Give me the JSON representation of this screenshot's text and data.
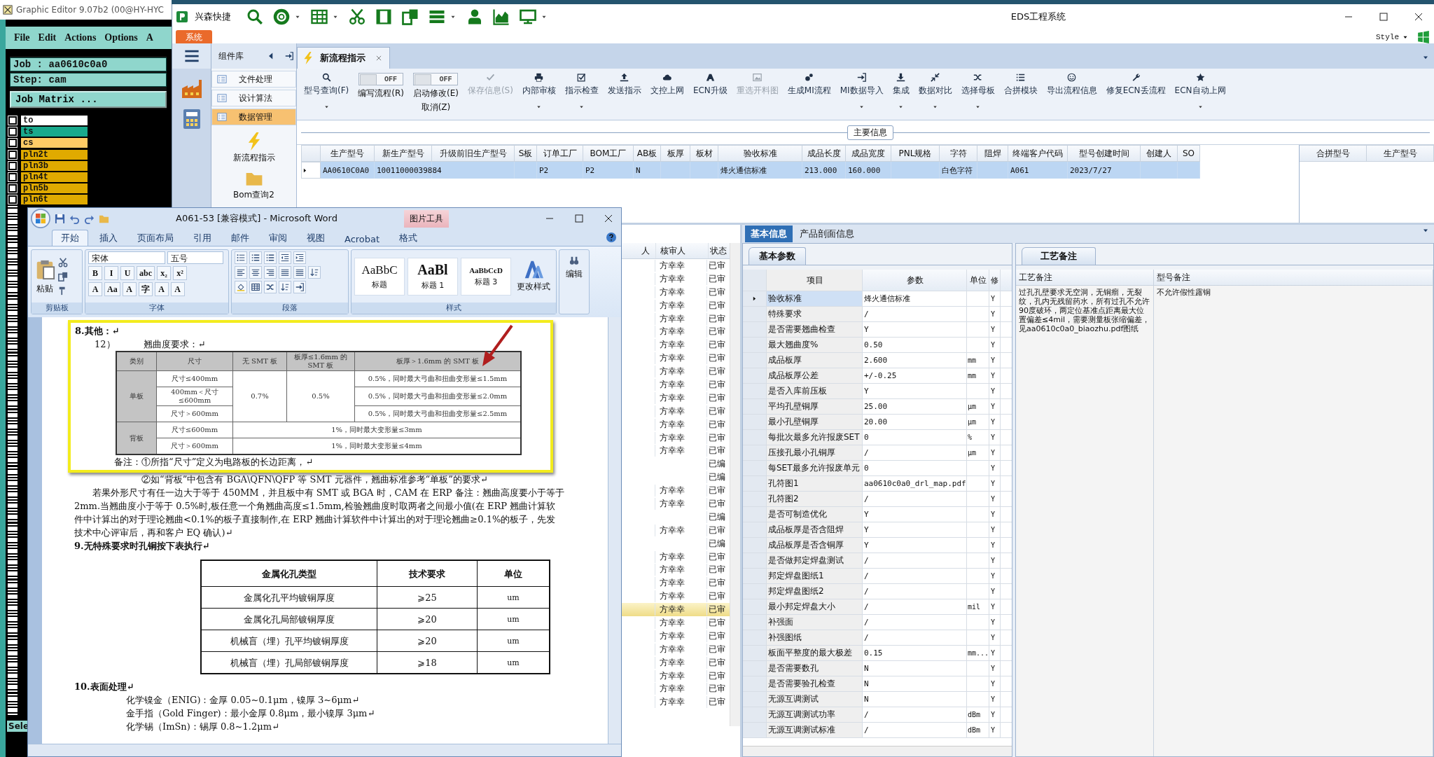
{
  "graphic_editor": {
    "title": "Graphic Editor 9.07b2 (00@HY-HYC",
    "menu": [
      "File",
      "Edit",
      "Actions",
      "Options",
      "A"
    ],
    "job": "Job : aa0610c0a0",
    "step": "Step: cam",
    "matrix_button": "Job Matrix ...",
    "layers": [
      {
        "name": "to",
        "color": "#ffffff"
      },
      {
        "name": "ts",
        "color": "#19a98c"
      },
      {
        "name": "cs",
        "color": "#ffcc66"
      },
      {
        "name": "pln2t",
        "color": "#e0aa00"
      },
      {
        "name": "pln3b",
        "color": "#e0aa00"
      },
      {
        "name": "pln4t",
        "color": "#e0aa00"
      },
      {
        "name": "pln5b",
        "color": "#e0aa00"
      },
      {
        "name": "pln6t",
        "color": "#e0aa00"
      }
    ],
    "status": "Sele"
  },
  "eds": {
    "title": "EDS工程系统",
    "quick_access_label": "兴森快捷",
    "app_tab": "系统",
    "style_menu": "Style",
    "component_panel": {
      "title": "组件库",
      "categories": [
        {
          "label": "文件处理",
          "selected": false
        },
        {
          "label": "设计算法",
          "selected": false
        },
        {
          "label": "数据管理",
          "selected": true
        }
      ],
      "items": [
        "新流程指示",
        "Bom查询2"
      ]
    },
    "doc_tab": "新流程指示",
    "ribbon": [
      {
        "kind": "button",
        "label": "型号查询(F)",
        "dropdown": true,
        "disabled": false
      },
      {
        "kind": "toggle",
        "text": "OFF",
        "on": false,
        "label": "编写流程(R)"
      },
      {
        "kind": "toggle",
        "text": "OFF",
        "on": false,
        "label": "启动修改(E)",
        "label2": "取消(Z)"
      },
      {
        "kind": "button",
        "label": "保存信息(S)",
        "dropdown": false,
        "disabled": true
      },
      {
        "kind": "button",
        "label": "内部审核",
        "dropdown": true,
        "disabled": false
      },
      {
        "kind": "button",
        "label": "指示检查",
        "dropdown": true,
        "disabled": false
      },
      {
        "kind": "button",
        "label": "发送指示",
        "dropdown": false,
        "disabled": false
      },
      {
        "kind": "button",
        "label": "文控上网",
        "dropdown": false,
        "disabled": false
      },
      {
        "kind": "button",
        "label": "ECN升级",
        "dropdown": false,
        "disabled": false
      },
      {
        "kind": "button",
        "label": "重选开料图",
        "dropdown": false,
        "disabled": true
      },
      {
        "kind": "button",
        "label": "生成MI流程",
        "dropdown": false,
        "disabled": false
      },
      {
        "kind": "button",
        "label": "MI数据导入",
        "dropdown": true,
        "disabled": false
      },
      {
        "kind": "button",
        "label": "集成",
        "dropdown": true,
        "disabled": false
      },
      {
        "kind": "button",
        "label": "数据对比",
        "dropdown": true,
        "disabled": false
      },
      {
        "kind": "button",
        "label": "选择母板",
        "dropdown": true,
        "disabled": false
      },
      {
        "kind": "button",
        "label": "合拼模块",
        "dropdown": false,
        "disabled": false
      },
      {
        "kind": "button",
        "label": "导出流程信息",
        "dropdown": false,
        "disabled": false
      },
      {
        "kind": "button",
        "label": "修复ECN丢流程",
        "dropdown": false,
        "disabled": false
      },
      {
        "kind": "button",
        "label": "ECN自动上网",
        "dropdown": true,
        "disabled": false
      }
    ],
    "main_info": {
      "title": "主要信息",
      "row_selected": true,
      "columns": [
        {
          "header": "生产型号",
          "value": "AA0610C0A0"
        },
        {
          "header": "新生产型号",
          "value": "10011000039884"
        },
        {
          "header": "升级前旧生产型号"
        },
        {
          "header": "S板"
        },
        {
          "header": "订单工厂",
          "value": "P2"
        },
        {
          "header": "BOM工厂",
          "value": "P2"
        },
        {
          "header": "AB板",
          "value": "N"
        },
        {
          "header": "板厚"
        },
        {
          "header": "板材"
        },
        {
          "header": "验收标准",
          "value": "烽火通信标准"
        },
        {
          "header": "成品长度",
          "value": "213.000"
        },
        {
          "header": "成品宽度",
          "value": "160.000"
        },
        {
          "header": "PNL规格"
        },
        {
          "header": "字符",
          "value": "白色字符"
        },
        {
          "header": "阻焊"
        },
        {
          "header": "终端客户代码",
          "value": "A061"
        },
        {
          "header": "型号创建时间",
          "value": "2023/7/27"
        },
        {
          "header": "创建人"
        },
        {
          "header": "SO"
        }
      ]
    },
    "merge_table": {
      "columns": [
        "合拼型号",
        "生产型号"
      ]
    },
    "review_list": {
      "columns": [
        "人",
        "核审人",
        "状态"
      ],
      "rows": [
        {
          "reviewer": "方幸幸",
          "status": "已审",
          "selected": false
        },
        {
          "reviewer": "方幸幸",
          "status": "已审",
          "selected": false
        },
        {
          "reviewer": "方幸幸",
          "status": "已审",
          "selected": false
        },
        {
          "reviewer": "方幸幸",
          "status": "已审",
          "selected": false
        },
        {
          "reviewer": "方幸幸",
          "status": "已审",
          "selected": false
        },
        {
          "reviewer": "方幸幸",
          "status": "已审",
          "selected": false
        },
        {
          "reviewer": "方幸幸",
          "status": "已审",
          "selected": false
        },
        {
          "reviewer": "方幸幸",
          "status": "已审",
          "selected": false
        },
        {
          "reviewer": "方幸幸",
          "status": "已审",
          "selected": false
        },
        {
          "reviewer": "方幸幸",
          "status": "已审",
          "selected": false
        },
        {
          "reviewer": "方幸幸",
          "status": "已审",
          "selected": false
        },
        {
          "reviewer": "方幸幸",
          "status": "已审",
          "selected": false
        },
        {
          "reviewer": "方幸幸",
          "status": "已审",
          "selected": false
        },
        {
          "reviewer": "方幸幸",
          "status": "已审",
          "selected": false
        },
        {
          "reviewer": "方幸幸",
          "status": "已审",
          "selected": false
        },
        {
          "status": "已编",
          "selected": false
        },
        {
          "status": "已编",
          "selected": false
        },
        {
          "reviewer": "方幸幸",
          "status": "已审",
          "selected": false
        },
        {
          "reviewer": "方幸幸",
          "status": "已审",
          "selected": false
        },
        {
          "status": "已编",
          "selected": false
        },
        {
          "reviewer": "方幸幸",
          "status": "已审",
          "selected": false
        },
        {
          "status": "已编",
          "selected": false
        },
        {
          "reviewer": "方幸幸",
          "status": "已审",
          "selected": false
        },
        {
          "reviewer": "方幸幸",
          "status": "已审",
          "selected": false
        },
        {
          "reviewer": "方幸幸",
          "status": "已审",
          "selected": false
        },
        {
          "reviewer": "方幸幸",
          "status": "已审",
          "selected": false
        },
        {
          "reviewer": "方幸幸",
          "status": "已审",
          "selected": true
        },
        {
          "reviewer": "方幸幸",
          "status": "已审",
          "selected": false
        },
        {
          "reviewer": "方幸幸",
          "status": "已审",
          "selected": false
        },
        {
          "reviewer": "方幸幸",
          "status": "已审",
          "selected": false
        },
        {
          "reviewer": "方幸幸",
          "status": "已审",
          "selected": false
        },
        {
          "reviewer": "方幸幸",
          "status": "已审",
          "selected": false
        },
        {
          "reviewer": "方幸幸",
          "status": "已审",
          "selected": false
        },
        {
          "reviewer": "方幸幸",
          "status": "已审",
          "selected": false
        }
      ]
    },
    "basic_info": {
      "tabs": [
        {
          "label": "基本信息",
          "selected": true
        },
        {
          "label": "产品剖面信息",
          "selected": false
        }
      ],
      "subtab": "基本参数",
      "columns": [
        "项目",
        "参数",
        "单位",
        "修"
      ],
      "rows": [
        {
          "item": "验收标准",
          "value": "烽火通信标准",
          "flag": "Y",
          "selected": true
        },
        {
          "item": "特殊要求",
          "value": "/",
          "flag": "Y",
          "selected": false
        },
        {
          "item": "是否需要翘曲检查",
          "value": "Y",
          "flag": "Y",
          "selected": false
        },
        {
          "item": "最大翘曲度%",
          "value": "0.50",
          "flag": "Y",
          "selected": false
        },
        {
          "item": "成品板厚",
          "value": "2.600",
          "unit": "mm",
          "flag": "Y",
          "selected": false
        },
        {
          "item": "成品板厚公差",
          "value": "+/-0.25",
          "unit": "mm",
          "flag": "Y",
          "selected": false
        },
        {
          "item": "是否入库前压板",
          "value": "Y",
          "flag": "Y",
          "selected": false
        },
        {
          "item": "平均孔壁铜厚",
          "value": "25.00",
          "unit": "μm",
          "flag": "Y",
          "selected": false
        },
        {
          "item": "最小孔壁铜厚",
          "value": "20.00",
          "unit": "μm",
          "flag": "Y",
          "selected": false
        },
        {
          "item": "每批次最多允许报废SET",
          "value": "0",
          "unit": "%",
          "flag": "Y",
          "selected": false
        },
        {
          "item": "压接孔最小孔铜厚",
          "value": "/",
          "unit": "μm",
          "flag": "Y",
          "selected": false
        },
        {
          "item": "每SET最多允许报废单元",
          "value": "0",
          "flag": "Y",
          "selected": false
        },
        {
          "item": "孔符图1",
          "value": "aa0610c0a0_drl_map.pdf",
          "flag": "Y",
          "selected": false
        },
        {
          "item": "孔符图2",
          "value": "/",
          "flag": "Y",
          "selected": false
        },
        {
          "item": "是否可制造优化",
          "value": "Y",
          "flag": "Y",
          "selected": false
        },
        {
          "item": "成品板厚是否含阻焊",
          "value": "Y",
          "flag": "Y",
          "selected": false
        },
        {
          "item": "成品板厚是否含铜厚",
          "value": "Y",
          "flag": "Y",
          "selected": false
        },
        {
          "item": "是否做邦定焊盘测试",
          "value": "/",
          "flag": "Y",
          "selected": false
        },
        {
          "item": "邦定焊盘图纸1",
          "value": "/",
          "flag": "Y",
          "selected": false
        },
        {
          "item": "邦定焊盘图纸2",
          "value": "/",
          "flag": "Y",
          "selected": false
        },
        {
          "item": "最小邦定焊盘大小",
          "value": "/",
          "unit": "mil",
          "flag": "Y",
          "selected": false
        },
        {
          "item": "补强面",
          "value": "/",
          "flag": "Y",
          "selected": false
        },
        {
          "item": "补强图纸",
          "value": "/",
          "flag": "Y",
          "selected": false
        },
        {
          "item": "板面平整度的最大极差",
          "value": "0.15",
          "unit": "mm...",
          "flag": "Y",
          "selected": false
        },
        {
          "item": "是否需要数孔",
          "value": "N",
          "flag": "Y",
          "selected": false
        },
        {
          "item": "是否需要验孔检查",
          "value": "N",
          "flag": "Y",
          "selected": false
        },
        {
          "item": "无源互调测试",
          "value": "N",
          "flag": "Y",
          "selected": false
        },
        {
          "item": "无源互调测试功率",
          "value": "/",
          "unit": "dBm",
          "flag": "Y",
          "selected": false
        },
        {
          "item": "无源互调测试标准",
          "value": "/",
          "unit": "dBm",
          "flag": "Y",
          "selected": false
        }
      ]
    },
    "process_notes": {
      "tab": "工艺备注",
      "columns": [
        "工艺备注",
        "型号备注"
      ],
      "process_note": "过孔孔壁要求无空洞，无铜瘤，无裂纹，孔内无残留药水，所有过孔不允许90度破环，两定位基准点距离最大位置偏差≤4mil，需要测量板张缩偏差，见aa0610c0a0_biaozhu.pdf图纸",
      "model_note": "不允许假性露铜"
    }
  },
  "word": {
    "title": "A061-53 [兼容模式] - Microsoft Word",
    "context_tab": "图片工具",
    "tabs": [
      {
        "label": "开始",
        "selected": true
      },
      {
        "label": "插入",
        "selected": false
      },
      {
        "label": "页面布局",
        "selected": false
      },
      {
        "label": "引用",
        "selected": false
      },
      {
        "label": "邮件",
        "selected": false
      },
      {
        "label": "审阅",
        "selected": false
      },
      {
        "label": "视图",
        "selected": false
      },
      {
        "label": "Acrobat",
        "selected": false
      },
      {
        "label": "格式",
        "selected": false
      }
    ],
    "ribbon": {
      "paste": "粘贴",
      "font": "宋体",
      "size": "五号",
      "font_buttons": [
        "B",
        "I",
        "U",
        "abc",
        "x₂",
        "x²"
      ],
      "format_buttons": [
        "A",
        "Aa",
        "A",
        "字",
        "A",
        "A"
      ],
      "styles": [
        {
          "preview": "AaBbC",
          "name": "标题"
        },
        {
          "preview": "AaBl",
          "name": "标题 1"
        },
        {
          "preview": "AaBbCcD",
          "name": "标题 3"
        }
      ],
      "change_styles": "更改样式",
      "editing": "编辑",
      "groups": [
        "剪贴板",
        "字体",
        "段落",
        "样式"
      ]
    },
    "document": {
      "heading_8": "8.其他：↵",
      "item_number": "12）",
      "item_title": "翘曲度要求：↵",
      "warp_table": {
        "header": [
          "类别",
          "尺寸",
          "无 SMT 板",
          "板厚≤1.6mm 的 SMT 板",
          "板厚＞1.6mm 的 SMT 板"
        ],
        "rows": [
          [
            {
              "text": "单板",
              "rowspan": 3
            },
            {
              "text": "尺寸≤400mm"
            },
            {
              "text": "0.7%",
              "rowspan": 3
            },
            {
              "text": "0.5%",
              "rowspan": 3
            },
            {
              "text": "0.5%，同时最大弓曲和扭曲变形量≤1.5mm"
            }
          ],
          [
            {
              "text": "400mm＜尺寸≤600mm"
            },
            {
              "text": "0.5%，同时最大弓曲和扭曲变形量≤2.0mm"
            }
          ],
          [
            {
              "text": "尺寸＞600mm"
            },
            {
              "text": "0.5%，同时最大弓曲和扭曲变形量≤2.5mm"
            }
          ],
          [
            {
              "text": "背板",
              "rowspan": 2
            },
            {
              "text": "尺寸≤600mm"
            },
            {
              "text": "1%，同时最大变形量≤3mm",
              "colspan": 3
            }
          ],
          [
            {
              "text": "尺寸＞600mm"
            },
            {
              "text": "1%，同时最大变形量≤4mm",
              "colspan": 3
            }
          ]
        ]
      },
      "note_1": "备注：①所指“尺寸”定义为电路板的长边距离，↵",
      "note_2": "②如“背板”中包含有 BGA\\QFN\\QFP 等 SMT 元器件，翘曲标准参考“单板”的要求↵",
      "paragraph": "若果外形尺寸有任一边大于等于 450MM，并且板中有 SMT 或 BGA 时，CAM 在 ERP 备注：翘曲高度要小于等于 2mm.当翘曲度小于等于 0.5%时,板任意一个角翘曲高度≤1.5mm,检验翘曲度时取两者之间最小值(在 ERP 翘曲计算软件中计算出的对于理论翘曲<0.1%的板子直接制作,在 ERP 翘曲计算软件中计算出的对于理论翘曲≥0.1%的板子，先发技术中心评审后，再和客户 EQ 确认)↵",
      "heading_9": "9.无特殊要求时孔铜按下表执行↵",
      "copper_table": {
        "header": [
          "金属化孔类型",
          "技术要求",
          "单位"
        ],
        "rows": [
          [
            "金属化孔平均镀铜厚度",
            "⩾25",
            "um"
          ],
          [
            "金属化孔局部镀铜厚度",
            "⩾20",
            "um"
          ],
          [
            "机械盲（埋）孔平均镀铜厚度",
            "⩾20",
            "um"
          ],
          [
            "机械盲（埋）孔局部镀铜厚度",
            "⩾18",
            "um"
          ]
        ]
      },
      "heading_10": "10.表面处理↵",
      "finish_lines": [
        "化学镍金（ENIG)：金厚 0.05~0.1μm，镍厚 3~6μm↵",
        "金手指（Gold Finger)：最小金厚 0.8μm，最小镍厚 3μm↵",
        "化学锡（ImSn)：锡厚 0.8~1.2μm↵"
      ]
    }
  }
}
